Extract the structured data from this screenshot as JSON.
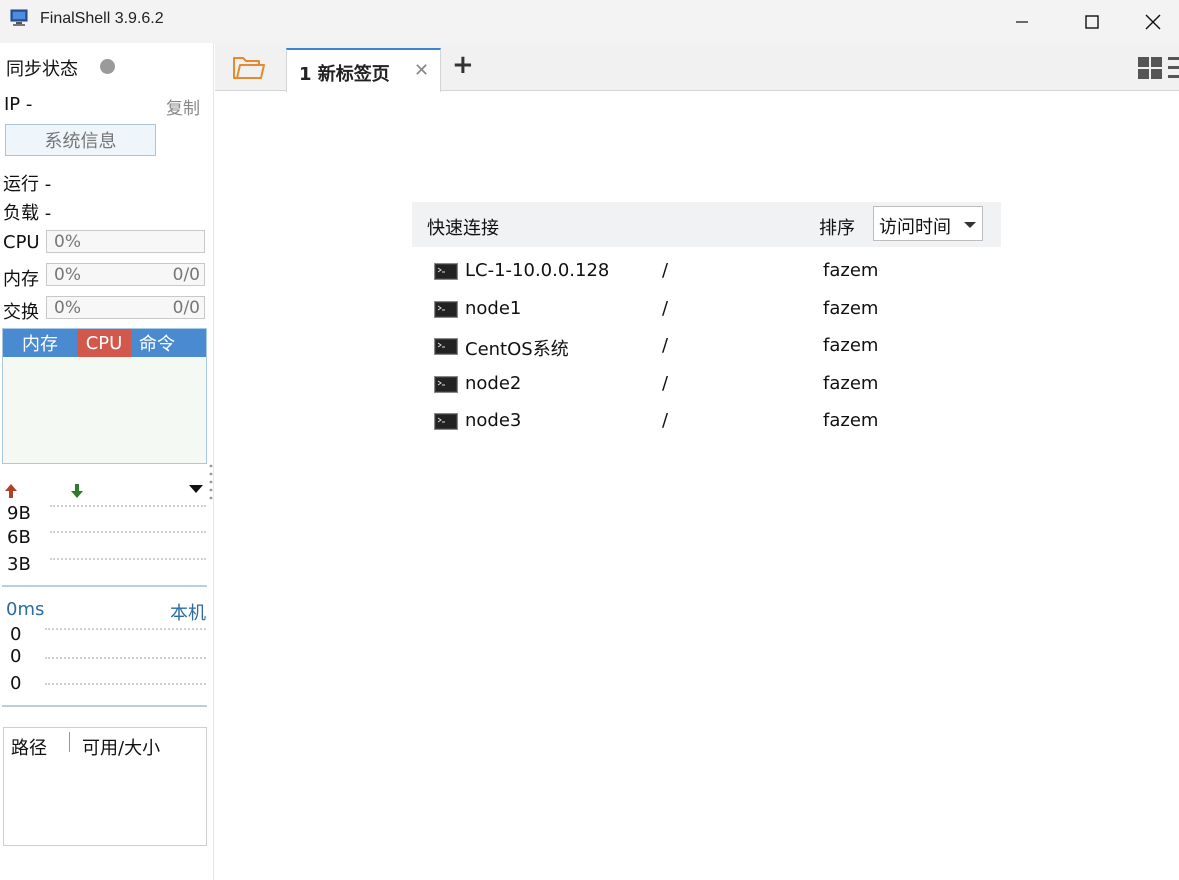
{
  "window": {
    "title": "FinalShell 3.9.6.2"
  },
  "sidebar": {
    "sync_status_label": "同步状态",
    "ip_label": "IP  -",
    "copy_label": "复制",
    "system_info_button": "系统信息",
    "uptime_label": "运行 -",
    "load_label": "负载 -",
    "cpu": {
      "label": "CPU",
      "percent": "0%"
    },
    "memory": {
      "label": "内存",
      "percent": "0%",
      "ratio": "0/0"
    },
    "swap": {
      "label": "交换",
      "percent": "0%",
      "ratio": "0/0"
    },
    "process_tabs": [
      {
        "label": "内存",
        "active": false
      },
      {
        "label": "CPU",
        "active": true
      },
      {
        "label": "命令",
        "active": false
      }
    ],
    "network": {
      "y_labels": [
        "9B",
        "6B",
        "3B"
      ]
    },
    "ping": {
      "latency": "0ms",
      "target": "本机",
      "y_labels": [
        "0",
        "0",
        "0"
      ]
    },
    "disk": {
      "col_path": "路径",
      "col_size": "可用/大小"
    }
  },
  "tabs": [
    {
      "label": "1 新标签页",
      "active": true
    }
  ],
  "quick_connect": {
    "title": "快速连接",
    "sort_label": "排序",
    "sort_value": "访问时间",
    "rows": [
      {
        "host": "LC-1-10.0.0.128",
        "path": "/",
        "user": "fazem"
      },
      {
        "host": "node1",
        "path": "/",
        "user": "fazem"
      },
      {
        "host": "CentOS系统",
        "path": "/",
        "user": "fazem"
      },
      {
        "host": "node2",
        "path": "/",
        "user": "fazem"
      },
      {
        "host": "node3",
        "path": "/",
        "user": "fazem"
      }
    ]
  },
  "colors": {
    "accent_blue": "#4a8ad0",
    "cpu_tab_red": "#d1584a",
    "folder_orange": "#e58a2e",
    "net_up": "#b0422a",
    "net_down": "#2f7a2f"
  }
}
